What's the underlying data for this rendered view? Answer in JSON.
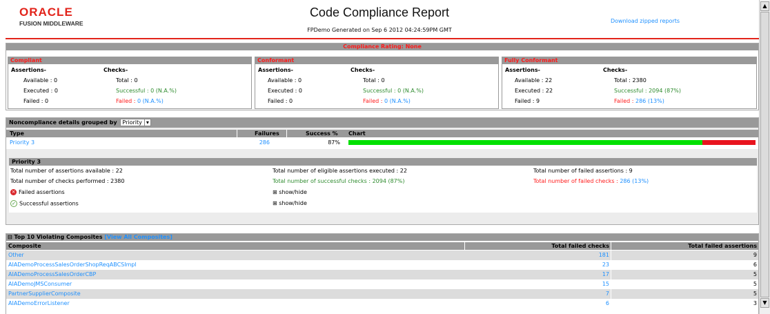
{
  "header": {
    "logo_top": "ORACLE",
    "logo_bottom": "FUSION MIDDLEWARE",
    "title": "Code Compliance Report",
    "subtitle": "FPDemo Generated on Sep 6 2012 04:24:59PM GMT",
    "download_link": "Download zipped reports"
  },
  "rating": {
    "label": "Compliance Rating: None",
    "boxes": [
      {
        "title": "Compliant",
        "assertions_header": "Assertions-",
        "checks_header": "Checks-",
        "available": "Available : 0",
        "executed": "Executed : 0",
        "failed": "Failed : 0",
        "total": "Total : 0",
        "successful": "Successful : 0 (N.A.%)",
        "failed_checks_label": "Failed : ",
        "failed_checks_value": "0 (N.A.%)"
      },
      {
        "title": "Conformant",
        "assertions_header": "Assertions-",
        "checks_header": "Checks-",
        "available": "Available : 0",
        "executed": "Executed : 0",
        "failed": "Failed : 0",
        "total": "Total : 0",
        "successful": "Successful : 0 (N.A.%)",
        "failed_checks_label": "Failed : ",
        "failed_checks_value": "0 (N.A.%)"
      },
      {
        "title": "Fully Conformant",
        "assertions_header": "Assertions-",
        "checks_header": "Checks-",
        "available": "Available : 22",
        "executed": "Executed : 22",
        "failed": "Failed : 9",
        "total": "Total : 2380",
        "successful": "Successful : 2094 (87%)",
        "failed_checks_label": "Failed : ",
        "failed_checks_value": "286 (13%)"
      }
    ]
  },
  "noncompliance": {
    "heading": "Noncompliance details grouped by",
    "group_by_value": "Priority",
    "columns": [
      "Type",
      "Failures",
      "Success %",
      "Chart"
    ],
    "rows": [
      {
        "type": "Priority 3",
        "failures": "286",
        "success": "87%",
        "success_fraction": 0.87
      }
    ],
    "colors": {
      "success": "#00e000",
      "failure": "#e8141e"
    }
  },
  "priority": {
    "heading": "Priority 3",
    "available": "Total number of assertions available : 22",
    "executed": "Total number of eligible assertions executed : 22",
    "failed_assertions": "Total number of failed assertions : 9",
    "checks_performed": "Total number of checks performed : 2380",
    "successful_checks": "Total number of successful checks : 2094 (87%)",
    "failed_checks_label": "Total number of failed checks : ",
    "failed_checks_value": "286 (13%)",
    "failed_assertions_link": "Failed assertions",
    "successful_assertions_link": "Successful assertions",
    "toggle_1": "show/hide",
    "toggle_2": "show/hide",
    "toggle_glyph": "⊞"
  },
  "composites": {
    "collapse_glyph": "⊟",
    "heading": "Top 10 Violating Composites",
    "view_all": "[View All Composites]",
    "columns": [
      "Composite",
      "Total failed checks",
      "Total failed assertions"
    ],
    "rows": [
      {
        "name": "Other",
        "checks": "181",
        "assertions": "9"
      },
      {
        "name": "AIADemoProcessSalesOrderShopReqABCSImpl",
        "checks": "23",
        "assertions": "6"
      },
      {
        "name": "AIADemoProcessSalesOrderCBP",
        "checks": "17",
        "assertions": "5"
      },
      {
        "name": "AIADemoJMSConsumer",
        "checks": "15",
        "assertions": "5"
      },
      {
        "name": "PartnerSupplierComposite",
        "checks": "7",
        "assertions": "5"
      },
      {
        "name": "AIADemoErrorListener",
        "checks": "6",
        "assertions": "3"
      }
    ]
  }
}
